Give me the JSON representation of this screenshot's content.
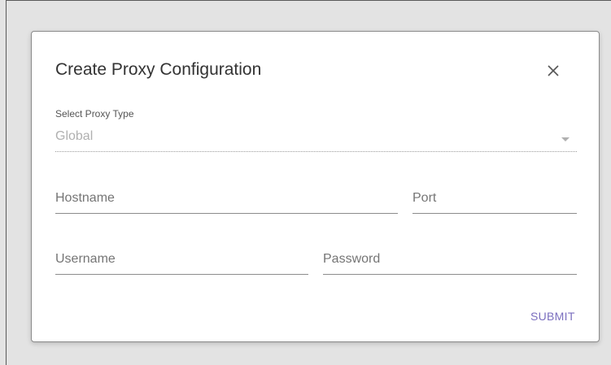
{
  "dialog": {
    "title": "Create Proxy Configuration",
    "close_icon": "close-icon"
  },
  "proxy_type": {
    "label": "Select Proxy Type",
    "value": "Global",
    "dropdown_icon": "chevron-down-icon"
  },
  "fields": {
    "hostname": {
      "placeholder": "Hostname",
      "value": ""
    },
    "port": {
      "placeholder": "Port",
      "value": ""
    },
    "username": {
      "placeholder": "Username",
      "value": ""
    },
    "password": {
      "placeholder": "Password",
      "value": ""
    }
  },
  "actions": {
    "submit_label": "SUBMIT"
  },
  "colors": {
    "accent": "#7b6fbf",
    "text_primary": "#333333",
    "text_placeholder": "#757575",
    "text_disabled": "#b0b0b0",
    "backdrop": "#e3e3e3"
  }
}
